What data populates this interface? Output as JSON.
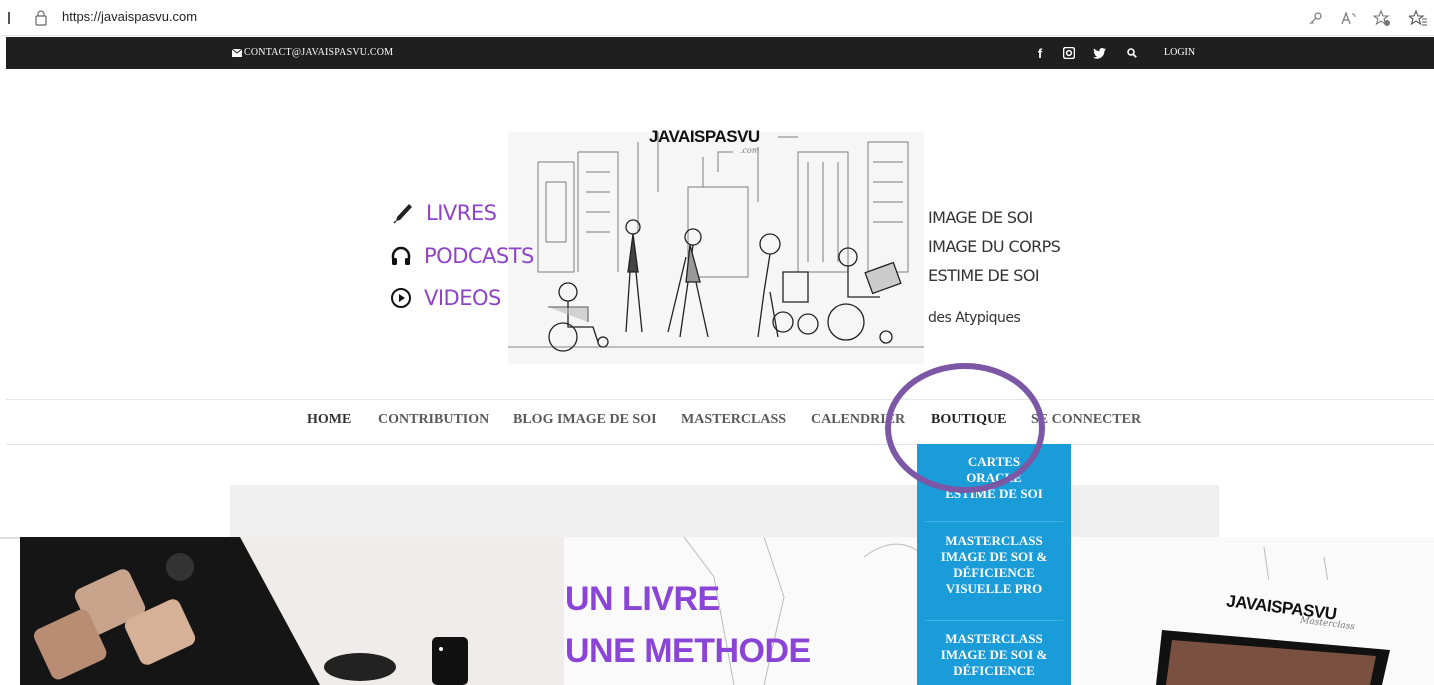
{
  "browser": {
    "url": "https://javaispasvu.com"
  },
  "topbar": {
    "contact": "CONTACT@JAVAISPASVU.COM",
    "login": "LOGIN"
  },
  "header": {
    "site_title": "JAVAISPASVU",
    "site_sub": ".com",
    "left_menu": [
      {
        "icon": "pencil-icon",
        "label": "LIVRES"
      },
      {
        "icon": "headphones-icon",
        "label": "PODCASTS"
      },
      {
        "icon": "play-circle-icon",
        "label": "VIDEOS"
      }
    ],
    "right_tags": [
      "IMAGE DE SOI",
      "IMAGE DU CORPS",
      "ESTIME DE SOI",
      "des Atypiques"
    ]
  },
  "nav": {
    "items": [
      "HOME",
      "CONTRIBUTION",
      "BLOG IMAGE DE SOI",
      "MASTERCLASS",
      "CALENDRIER",
      "BOUTIQUE",
      "SE CONNECTER"
    ],
    "active": "BOUTIQUE"
  },
  "dropdown": {
    "items": [
      [
        "CARTES",
        "ORACLE",
        "ESTIME DE SOI"
      ],
      [
        "MASTERCLASS",
        "IMAGE DE SOI &",
        "DÉFICIENCE",
        "VISUELLE PRO"
      ],
      [
        "MASTERCLASS",
        "IMAGE DE SOI &",
        "DÉFICIENCE"
      ]
    ]
  },
  "hero": {
    "line1": "UN LIVRE",
    "line2": "UNE METHODE",
    "book_title": "JAVAISPASVU",
    "book_sub": "Masterclass"
  },
  "colors": {
    "accent_purple": "#8e44c9",
    "dropdown_blue": "#1a9cd8",
    "topbar_dark": "#1f1f1f",
    "highlight_circle": "#7b57a6"
  }
}
